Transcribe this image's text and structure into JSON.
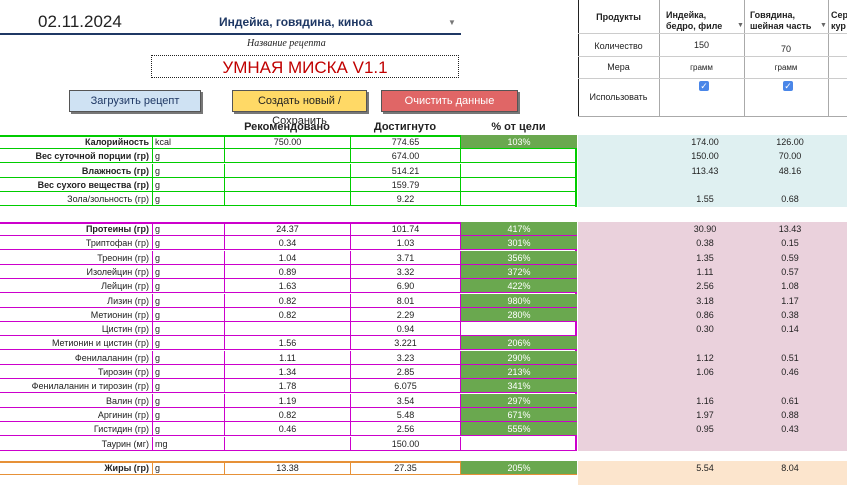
{
  "header": {
    "date": "02.11.2024",
    "recipe_title": "Индейка, говядина, киноа",
    "recipe_caption": "Название рецепта",
    "app_title": "УМНАЯ МИСКА V1.1",
    "buttons": {
      "load": "Загрузить рецепт",
      "create": "Создать новый / Сохранить",
      "clear": "Очистить данные"
    }
  },
  "products_panel": {
    "labels": {
      "products": "Продукты",
      "quantity": "Количество",
      "measure": "Мера",
      "use": "Использовать"
    },
    "items": [
      {
        "name_line1": "Индейка,",
        "name_line2": "бедро, филе",
        "quantity": "150",
        "measure": "грамм",
        "use": true
      },
      {
        "name_line1": "Говядина,",
        "name_line2": "шейная часть",
        "quantity": "70",
        "measure": "грамм",
        "use": true
      },
      {
        "name_line1": "Сер",
        "name_line2": "кур"
      }
    ]
  },
  "table": {
    "headers": {
      "recommended": "Рекомендовано",
      "achieved": "Достигнуто",
      "percent": "% от цели"
    },
    "colors": {
      "green_fill": "#6aa84f",
      "green_border": "#00cc00",
      "magenta_border": "#cc00cc",
      "orange_border": "#e69138",
      "cyan_bg": "#dff0f1",
      "pink_bg": "#ead1dc",
      "peach_bg": "#fce5cd"
    },
    "groups": [
      {
        "key": "energy",
        "rows": [
          {
            "label": "Калорийность",
            "bold": true,
            "unit": "kcal",
            "rec": "750.00",
            "ach": "774.65",
            "pct": "103%",
            "p1": "174.00",
            "p2": "126.00"
          },
          {
            "label": "Вес суточной порции (гр)",
            "bold": true,
            "unit": "g",
            "rec": "",
            "ach": "674.00",
            "pct": "",
            "p1": "150.00",
            "p2": "70.00"
          },
          {
            "label": "Влажность (гр)",
            "bold": true,
            "unit": "g",
            "rec": "",
            "ach": "514.21",
            "pct": "",
            "p1": "113.43",
            "p2": "48.16"
          },
          {
            "label": "Вес сухого вещества (гр)",
            "bold": true,
            "unit": "g",
            "rec": "",
            "ach": "159.79",
            "pct": "",
            "p1": "",
            "p2": ""
          },
          {
            "label": "Зола/зольность (гр)",
            "bold": false,
            "unit": "g",
            "rec": "",
            "ach": "9.22",
            "pct": "",
            "p1": "1.55",
            "p2": "0.68"
          }
        ]
      },
      {
        "key": "protein",
        "rows": [
          {
            "label": "Протеины (гр)",
            "bold": true,
            "unit": "g",
            "rec": "24.37",
            "ach": "101.74",
            "pct": "417%",
            "p1": "30.90",
            "p2": "13.43"
          },
          {
            "label": "Триптофан (гр)",
            "bold": false,
            "unit": "g",
            "rec": "0.34",
            "ach": "1.03",
            "pct": "301%",
            "p1": "0.38",
            "p2": "0.15"
          },
          {
            "label": "Треонин (гр)",
            "bold": false,
            "unit": "g",
            "rec": "1.04",
            "ach": "3.71",
            "pct": "356%",
            "p1": "1.35",
            "p2": "0.59"
          },
          {
            "label": "Изолейцин (гр)",
            "bold": false,
            "unit": "g",
            "rec": "0.89",
            "ach": "3.32",
            "pct": "372%",
            "p1": "1.11",
            "p2": "0.57"
          },
          {
            "label": "Лейцин (гр)",
            "bold": false,
            "unit": "g",
            "rec": "1.63",
            "ach": "6.90",
            "pct": "422%",
            "p1": "2.56",
            "p2": "1.08"
          },
          {
            "label": "Лизин (гр)",
            "bold": false,
            "unit": "g",
            "rec": "0.82",
            "ach": "8.01",
            "pct": "980%",
            "p1": "3.18",
            "p2": "1.17"
          },
          {
            "label": "Метионин (гр)",
            "bold": false,
            "unit": "g",
            "rec": "0.82",
            "ach": "2.29",
            "pct": "280%",
            "p1": "0.86",
            "p2": "0.38"
          },
          {
            "label": "Цистин (гр)",
            "bold": false,
            "unit": "g",
            "rec": "",
            "ach": "0.94",
            "pct": "",
            "p1": "0.30",
            "p2": "0.14"
          },
          {
            "label": "Метионин и цистин (гр)",
            "bold": false,
            "unit": "g",
            "rec": "1.56",
            "ach": "3.221",
            "pct": "206%",
            "p1": "",
            "p2": ""
          },
          {
            "label": "Фенилаланин (гр)",
            "bold": false,
            "unit": "g",
            "rec": "1.11",
            "ach": "3.23",
            "pct": "290%",
            "p1": "1.12",
            "p2": "0.51"
          },
          {
            "label": "Тирозин (гр)",
            "bold": false,
            "unit": "g",
            "rec": "1.34",
            "ach": "2.85",
            "pct": "213%",
            "p1": "1.06",
            "p2": "0.46"
          },
          {
            "label": "Фенилаланин и тирозин (гр)",
            "bold": false,
            "unit": "g",
            "rec": "1.78",
            "ach": "6.075",
            "pct": "341%",
            "p1": "",
            "p2": ""
          },
          {
            "label": "Валин (гр)",
            "bold": false,
            "unit": "g",
            "rec": "1.19",
            "ach": "3.54",
            "pct": "297%",
            "p1": "1.16",
            "p2": "0.61"
          },
          {
            "label": "Аргинин (гр)",
            "bold": false,
            "unit": "g",
            "rec": "0.82",
            "ach": "5.48",
            "pct": "671%",
            "p1": "1.97",
            "p2": "0.88"
          },
          {
            "label": "Гистидин (гр)",
            "bold": false,
            "unit": "g",
            "rec": "0.46",
            "ach": "2.56",
            "pct": "555%",
            "p1": "0.95",
            "p2": "0.43"
          },
          {
            "label": "Таурин (мг)",
            "bold": false,
            "unit": "mg",
            "rec": "",
            "ach": "150.00",
            "pct": "",
            "p1": "",
            "p2": ""
          }
        ]
      },
      {
        "key": "fat",
        "rows": [
          {
            "label": "Жиры (гр)",
            "bold": true,
            "unit": "g",
            "rec": "13.38",
            "ach": "27.35",
            "pct": "205%",
            "p1": "5.54",
            "p2": "8.04"
          }
        ]
      }
    ]
  }
}
